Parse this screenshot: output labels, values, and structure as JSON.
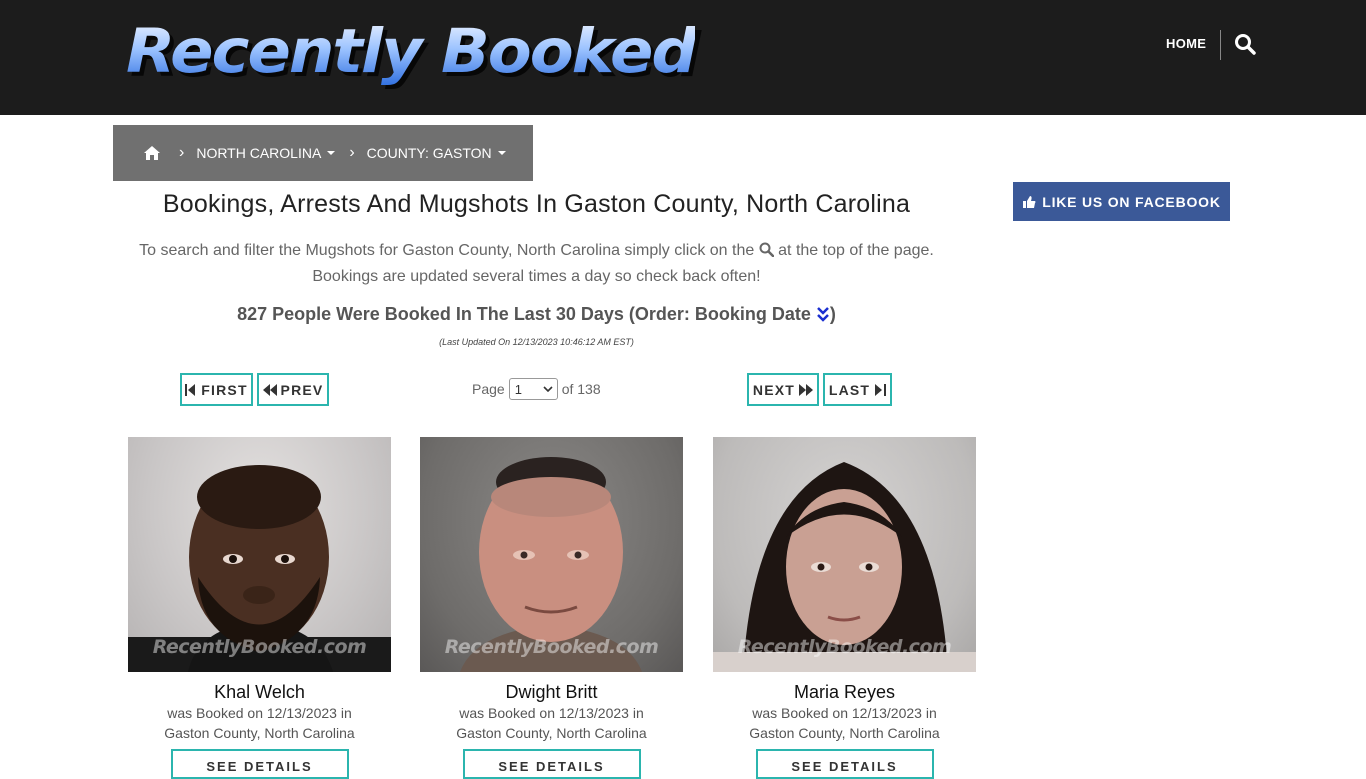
{
  "header": {
    "logo": "Recently Booked",
    "nav_home": "HOME"
  },
  "breadcrumb": {
    "state": "NORTH CAROLINA",
    "county": "COUNTY: GASTON"
  },
  "facebook_button": "LIKE US ON FACEBOOK",
  "main": {
    "title": "Bookings, Arrests And Mugshots In Gaston County, North Carolina",
    "desc_before": "To search and filter the Mugshots for Gaston County, North Carolina simply click on the",
    "desc_after": "at the top of the page.",
    "desc_line2": "Bookings are updated several times a day so check back often!",
    "count_text": "827 People Were Booked In The Last 30 Days (Order: Booking Date",
    "count_close": ")",
    "updated": "(Last Updated On 12/13/2023 10:46:12 AM EST)"
  },
  "pagination": {
    "first": "FIRST",
    "prev": "PREV",
    "next": "NEXT",
    "last": "LAST",
    "page_label": "Page",
    "page_value": "1",
    "of_label": "of 138"
  },
  "watermark": "RecentlyBooked.com",
  "bookings": [
    {
      "name": "Khal Welch",
      "line1": "was Booked on 12/13/2023 in",
      "line2": "Gaston County, North Carolina",
      "button": "SEE DETAILS"
    },
    {
      "name": "Dwight Britt",
      "line1": "was Booked on 12/13/2023 in",
      "line2": "Gaston County, North Carolina",
      "button": "SEE DETAILS"
    },
    {
      "name": "Maria Reyes",
      "line1": "was Booked on 12/13/2023 in",
      "line2": "Gaston County, North Carolina",
      "button": "SEE DETAILS"
    }
  ],
  "colors": {
    "header_bg": "#1c1c1c",
    "breadcrumb_bg": "#707070",
    "facebook_bg": "#3b5998",
    "accent_border": "#2bb5ae"
  }
}
